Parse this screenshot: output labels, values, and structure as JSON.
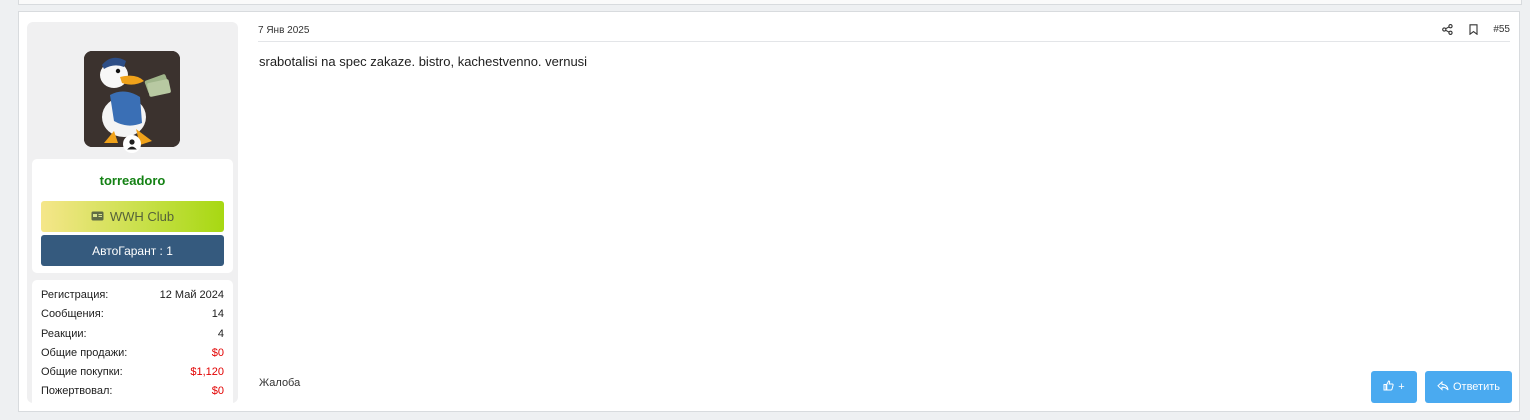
{
  "user": {
    "username": "torreadoro",
    "club_banner": "WWH Club",
    "guarantee_banner": "АвтоГарант : 1",
    "stats": [
      {
        "label": "Регистрация:",
        "value": "12 Май 2024",
        "highlight": false
      },
      {
        "label": "Сообщения:",
        "value": "14",
        "highlight": false
      },
      {
        "label": "Реакции:",
        "value": "4",
        "highlight": false
      },
      {
        "label": "Общие продажи:",
        "value": "$0",
        "highlight": true
      },
      {
        "label": "Общие покупки:",
        "value": "$1,120",
        "highlight": true
      },
      {
        "label": "Пожертвовал:",
        "value": "$0",
        "highlight": true
      }
    ]
  },
  "post": {
    "date": "7 Янв 2025",
    "number": "#55",
    "body": "srabotalisi na spec zakaze. bistro, kachestvenno. vernusi",
    "report_label": "Жалоба",
    "like_label": "+",
    "reply_label": "Ответить"
  },
  "icons": {
    "share": "share-icon",
    "bookmark": "bookmark-icon",
    "like": "thumbs-up-icon",
    "reply": "reply-icon",
    "club": "id-card-icon",
    "avatar_badge": "user-icon"
  },
  "colors": {
    "username": "#138113",
    "guarantee_banner": "#355a7e",
    "button": "#4aaaf0",
    "negative_value": "#e20000"
  }
}
